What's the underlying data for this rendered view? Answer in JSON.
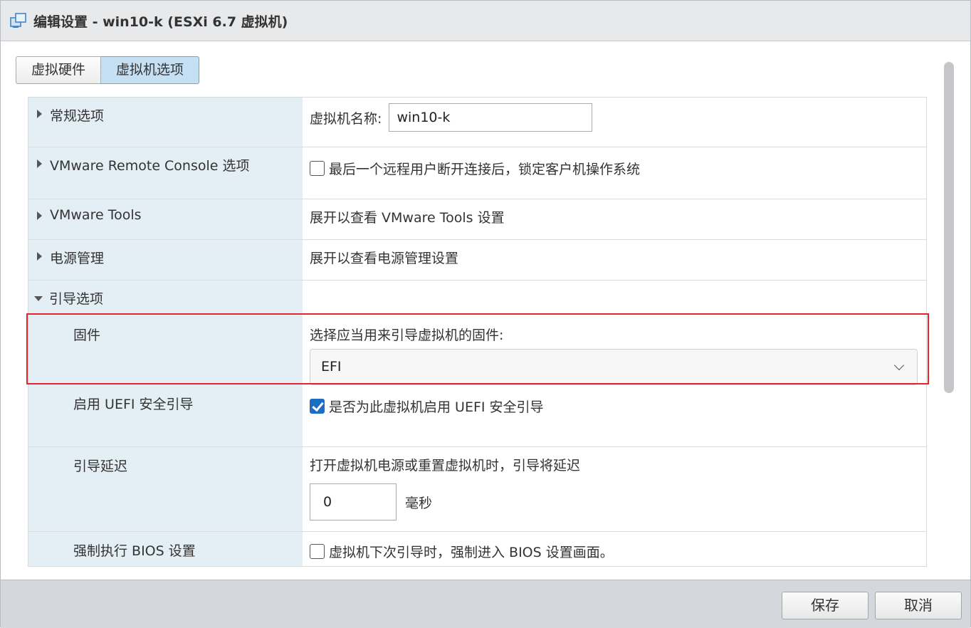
{
  "window": {
    "title": "编辑设置 - win10-k (ESXi 6.7 虚拟机)"
  },
  "tabs": [
    {
      "label": "虚拟硬件",
      "active": false
    },
    {
      "label": "虚拟机选项",
      "active": true
    }
  ],
  "rows": {
    "general": {
      "label": "常规选项",
      "vm_name_label": "虚拟机名称:",
      "vm_name_value": "win10-k"
    },
    "vmrc": {
      "label": "VMware Remote Console 选项",
      "lock_checkbox_label": "最后一个远程用户断开连接后，锁定客户机操作系统",
      "lock_checked": false
    },
    "tools": {
      "label": "VMware Tools",
      "hint": "展开以查看 VMware Tools 设置"
    },
    "power": {
      "label": "电源管理",
      "hint": "展开以查看电源管理设置"
    },
    "boot": {
      "label": "引导选项",
      "firmware": {
        "label": "固件",
        "prompt": "选择应当用来引导虚拟机的固件:",
        "selected": "EFI"
      },
      "secure_boot": {
        "label": "启用 UEFI 安全引导",
        "checkbox_label": "是否为此虚拟机启用 UEFI 安全引导",
        "checked": true
      },
      "boot_delay": {
        "label": "引导延迟",
        "description": "打开虚拟机电源或重置虚拟机时，引导将延迟",
        "value": "0",
        "unit": "毫秒"
      },
      "force_bios": {
        "label": "强制执行 BIOS 设置",
        "checkbox_label": "虚拟机下次引导时，强制进入 BIOS 设置画面。",
        "checked": false
      }
    }
  },
  "footer": {
    "save_label": "保存",
    "cancel_label": "取消"
  },
  "colors": {
    "highlight": "#e0262c",
    "accent": "#1b6ec2",
    "label_bg": "#e4eef5"
  }
}
